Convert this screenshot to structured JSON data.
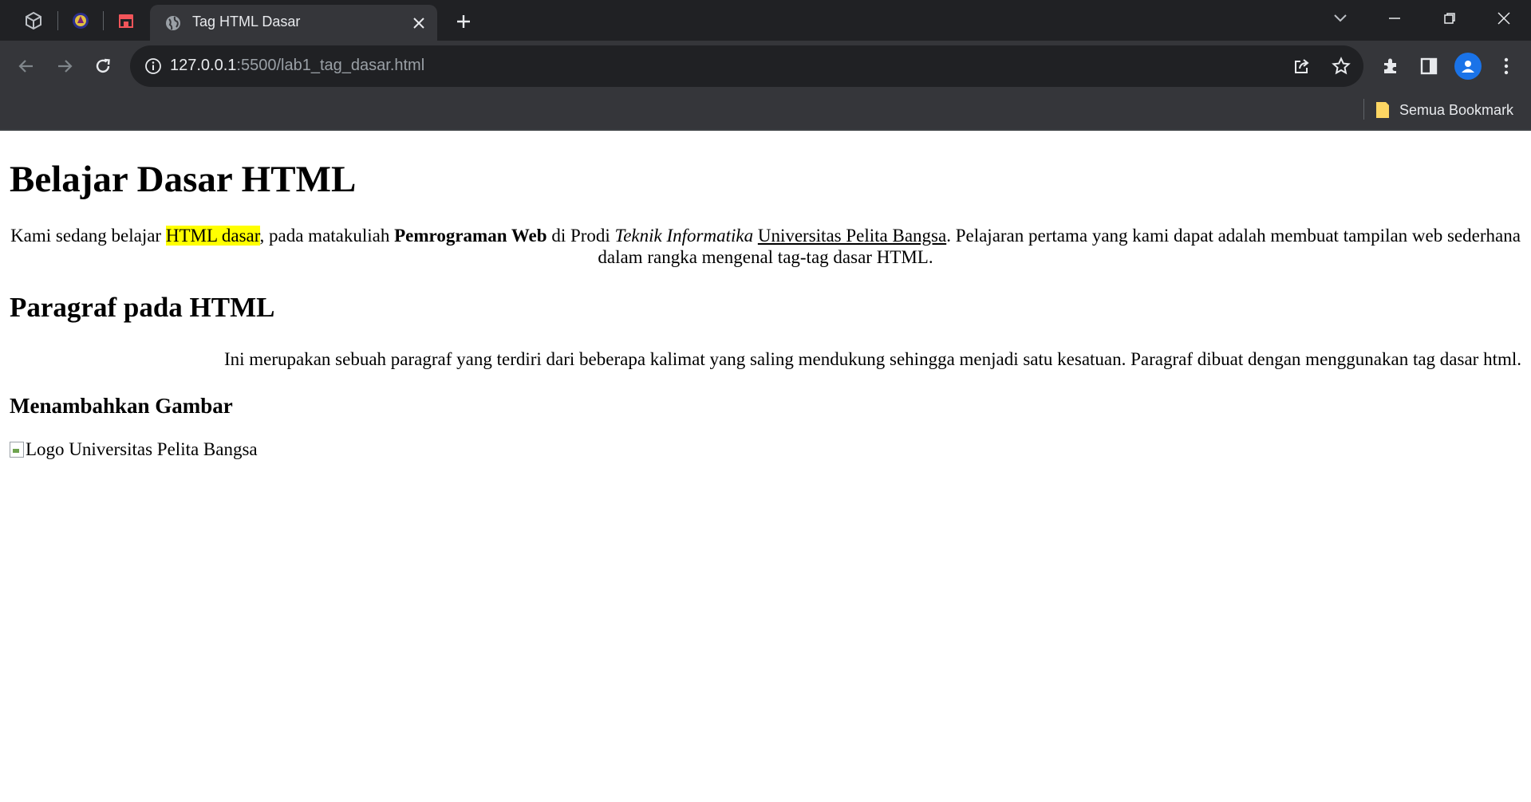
{
  "browser": {
    "active_tab_title": "Tag HTML Dasar",
    "url_host": "127.0.0.1",
    "url_rest": ":5500/lab1_tag_dasar.html",
    "bookmark_label": "Semua Bookmark",
    "pinned_icons": [
      "unity-icon",
      "university-logo-icon",
      "store-icon"
    ]
  },
  "page": {
    "h1": "Belajar Dasar HTML",
    "p1": {
      "t1": "Kami sedang belajar ",
      "mark": "HTML dasar",
      "t2": ", pada matakuliah ",
      "bold": "Pemrograman Web",
      "t3": " di Prodi ",
      "italic": "Teknik Informatika",
      "t4": " ",
      "underline": "Universitas Pelita Bangsa",
      "t5": ". Pelajaran pertama yang kami dapat adalah membuat tampilan web sederhana dalam rangka mengenal tag-tag dasar HTML."
    },
    "h2": "Paragraf pada HTML",
    "p2": "Ini merupakan sebuah paragraf yang terdiri dari beberapa kalimat yang saling mendukung sehingga menjadi satu kesatuan. Paragraf dibuat dengan menggunakan tag dasar html.",
    "h3": "Menambahkan Gambar",
    "img_alt": "Logo Universitas Pelita Bangsa"
  }
}
